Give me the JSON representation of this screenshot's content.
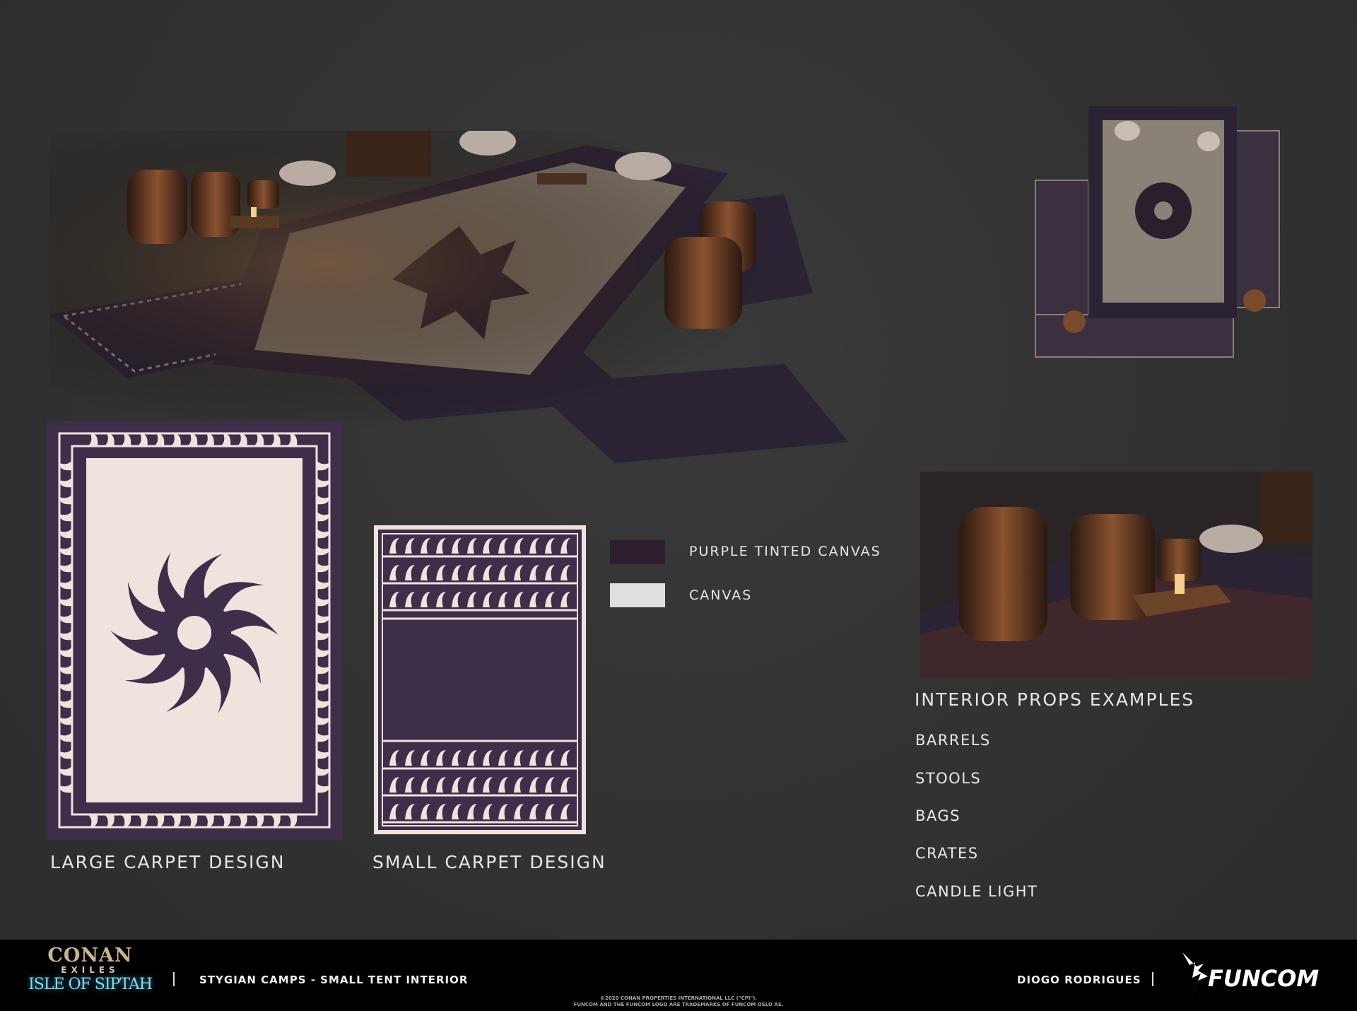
{
  "designs": {
    "large_label": "LARGE CARPET DESIGN",
    "small_label": "SMALL CARPET DESIGN"
  },
  "legend": {
    "items": [
      {
        "label": "PURPLE TINTED CANVAS",
        "color": "#2e1f2e"
      },
      {
        "label": "CANVAS",
        "color": "#e0dede"
      }
    ]
  },
  "colors": {
    "purple": "#3d2e4a",
    "cream": "#efe3dd"
  },
  "props": {
    "title": "INTERIOR PROPS EXAMPLES",
    "items": [
      "BARRELS",
      "STOOLS",
      "BAGS",
      "CRATES",
      "CANDLE LIGHT"
    ]
  },
  "footer": {
    "logo_text": {
      "line1": "CONAN",
      "line2": "EXILES",
      "line3": "ISLE OF SIPTAH"
    },
    "title": "STYGIAN CAMPS - SMALL TENT  INTERIOR",
    "author": "DIOGO RODRIGUES",
    "brand": "FUNCOM",
    "copyright1": "©2020 CONAN PROPERTIES INTERNATIONAL LLC (\"CPI\").",
    "copyright2": "FUNCOM AND THE FUNCOM LOGO ARE TRADEMARKS OF FUNCOM OSLO AS."
  }
}
